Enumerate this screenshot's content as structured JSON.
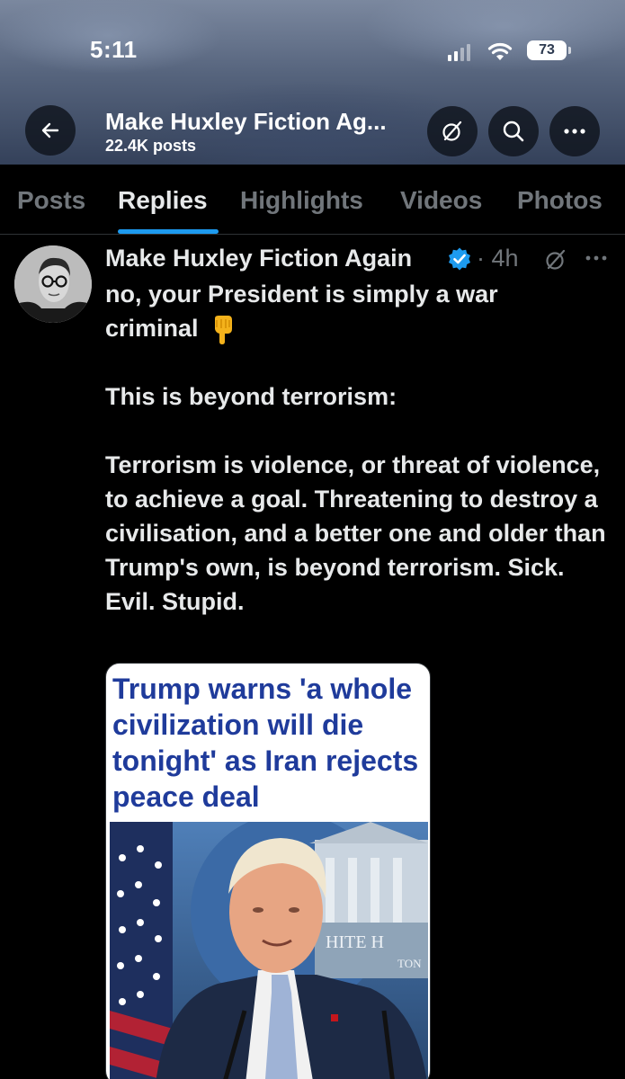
{
  "status_bar": {
    "time": "5:11",
    "battery": "73",
    "signal_bars_filled": 2,
    "signal_bars_total": 4
  },
  "header": {
    "title": "Make Huxley Fiction Ag...",
    "subtitle": "22.4K posts",
    "icons": [
      "back-arrow-icon",
      "grok-icon",
      "search-icon",
      "more-icon"
    ]
  },
  "tabs": [
    {
      "label": "Posts",
      "active": false
    },
    {
      "label": "Replies",
      "active": true
    },
    {
      "label": "Highlights",
      "active": false
    },
    {
      "label": "Videos",
      "active": false
    },
    {
      "label": "Photos",
      "active": false
    }
  ],
  "post": {
    "author": "Make Huxley Fiction Again",
    "time": "· 4h",
    "line1": "no, your President is simply a war",
    "line2": "criminal",
    "para2": "This is beyond terrorism:",
    "para3": "Terrorism is violence, or threat of violence, to achieve a goal. Threatening to destroy a civilisation, and a better one and older than Trump's own, is beyond terrorism. Sick. Evil. Stupid.",
    "media": {
      "headline": "Trump warns 'a whole civilization will die tonight' as Iran rejects peace deal",
      "sign_text": "HITE H",
      "sign_text2": "TON"
    }
  },
  "colors": {
    "accent": "#1d9bf0",
    "background": "#000000",
    "muted_text": "#71767b",
    "headline_blue": "#1f3b9b"
  }
}
